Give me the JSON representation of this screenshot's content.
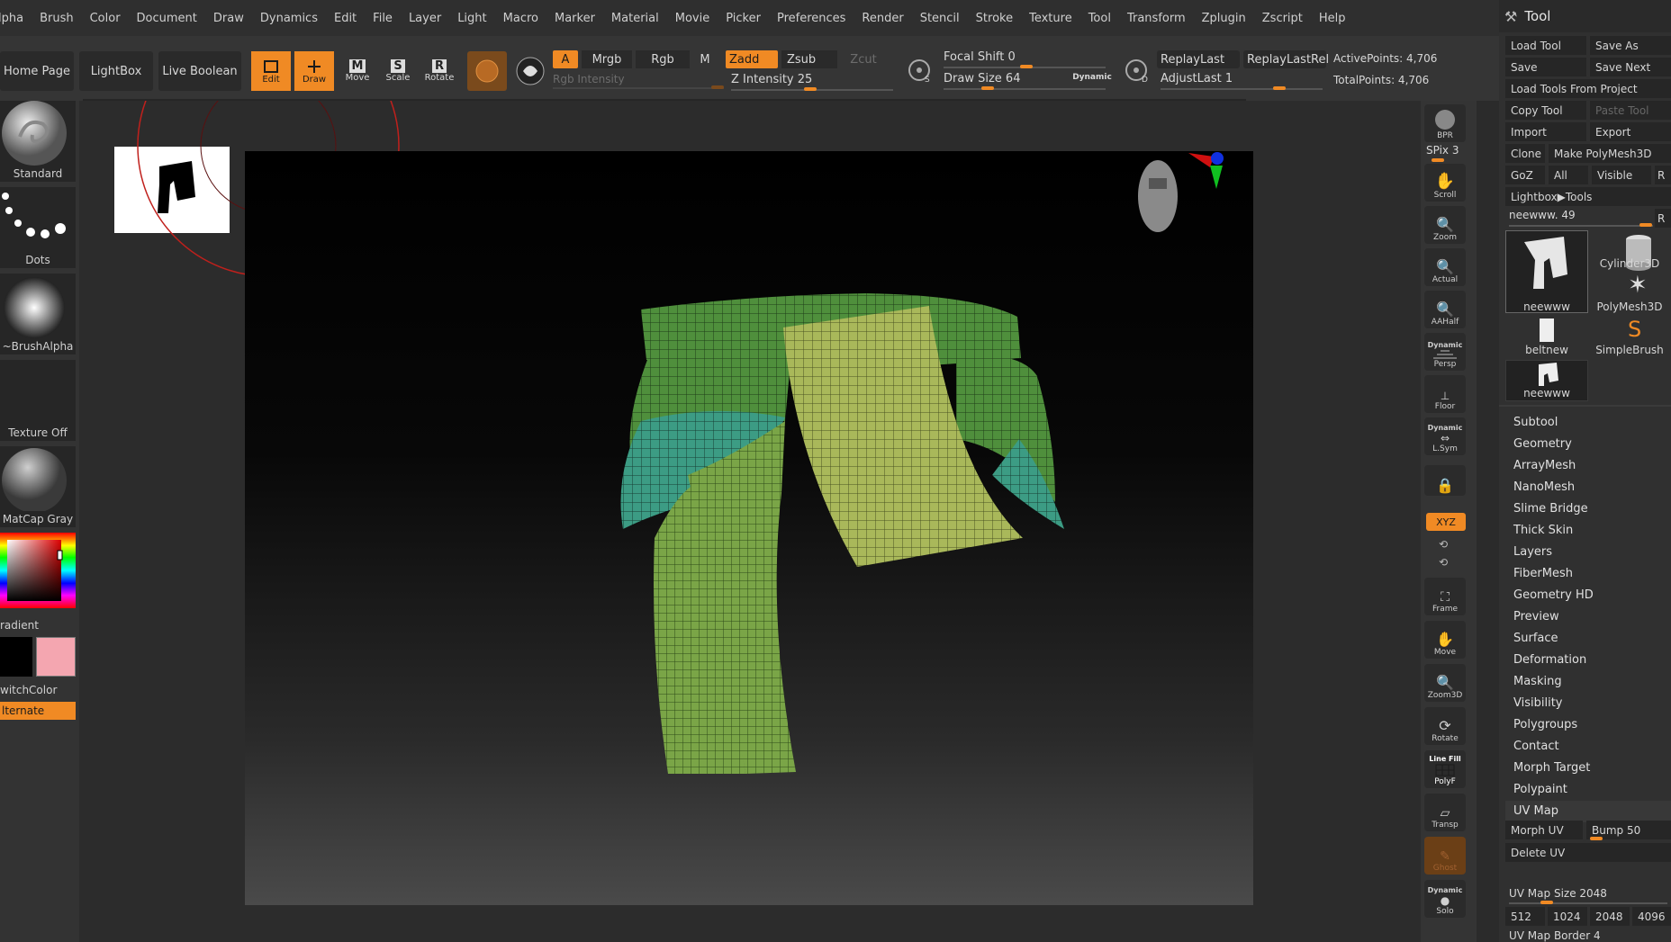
{
  "menubar": [
    "lpha",
    "Brush",
    "Color",
    "Document",
    "Draw",
    "Dynamics",
    "Edit",
    "File",
    "Layer",
    "Light",
    "Macro",
    "Marker",
    "Material",
    "Movie",
    "Picker",
    "Preferences",
    "Render",
    "Stencil",
    "Stroke",
    "Texture",
    "Tool",
    "Transform",
    "Zplugin",
    "Zscript",
    "Help"
  ],
  "toolbar": {
    "home_page": "Home Page",
    "lightbox": "LightBox",
    "live_boolean": "Live Boolean",
    "edit": "Edit",
    "draw": "Draw",
    "move": "Move",
    "scale": "Scale",
    "rotate": "Rotate",
    "a": "A",
    "mrgb": "Mrgb",
    "rgb": "Rgb",
    "m": "M",
    "rgb_intensity": "Rgb Intensity",
    "zadd": "Zadd",
    "zsub": "Zsub",
    "zcut": "Zcut",
    "z_intensity_label": "Z Intensity",
    "z_intensity_value": "25",
    "focal_shift_label": "Focal Shift",
    "focal_shift_value": "0",
    "draw_size_label": "Draw Size",
    "draw_size_value": "64",
    "dynamic": "Dynamic",
    "replay_last": "ReplayLast",
    "replay_last_rel": "ReplayLastRel",
    "adjust_last_label": "AdjustLast",
    "adjust_last_value": "1",
    "active_points": "ActivePoints: 4,706",
    "total_points": "TotalPoints: 4,706"
  },
  "leftshelf": {
    "standard": "Standard",
    "dots": "Dots",
    "brush_alpha": "~BrushAlpha",
    "texture_off": "Texture Off",
    "matcap": "MatCap Gray",
    "gradient": "radient",
    "switch_color": "witchColor",
    "alternate": "lternate",
    "secondary_color": "#f4a6b0"
  },
  "rightshelf": {
    "bpr": "BPR",
    "spix_label": "SPix",
    "spix_value": "3",
    "scroll": "Scroll",
    "zoom": "Zoom",
    "actual": "Actual",
    "aahalf": "AAHalf",
    "dynamic": "Dynamic",
    "persp": "Persp",
    "floor": "Floor",
    "dynamic2": "Dynamic",
    "lsym": "L.Sym",
    "xyz": "XYZ",
    "frame": "Frame",
    "move": "Move",
    "zoom3d": "Zoom3D",
    "rotate": "Rotate",
    "line_fill": "Line Fill",
    "polyf": "PolyF",
    "transp": "Transp",
    "ghost": "Ghost",
    "dynamic3": "Dynamic",
    "solo": "Solo"
  },
  "tool": {
    "title": "Tool",
    "load_tool": "Load Tool",
    "save_as": "Save As",
    "save": "Save",
    "save_next": "Save Next",
    "load_tools_from_project": "Load Tools From Project",
    "copy_tool": "Copy Tool",
    "paste_tool": "Paste Tool",
    "import": "Import",
    "export": "Export",
    "clone": "Clone",
    "make_polymesh": "Make PolyMesh3D",
    "goz": "GoZ",
    "all": "All",
    "visible": "Visible",
    "r": "R",
    "lightbox_tools": "Lightbox▶Tools",
    "current_tool_label": "neewww.",
    "current_tool_value": "49",
    "thumbs": [
      "neewww",
      "Cylinder3D",
      "PolyMesh3D",
      "beltnew",
      "SimpleBrush",
      "neewww"
    ],
    "sections": [
      "Subtool",
      "Geometry",
      "ArrayMesh",
      "NanoMesh",
      "Slime Bridge",
      "Thick Skin",
      "Layers",
      "FiberMesh",
      "Geometry HD",
      "Preview",
      "Surface",
      "Deformation",
      "Masking",
      "Visibility",
      "Polygroups",
      "Contact",
      "Morph Target",
      "Polypaint",
      "UV Map"
    ],
    "morph_uv": "Morph UV",
    "bump_label": "Bump",
    "bump_value": "50",
    "delete_uv": "Delete UV",
    "uv_map_size_label": "UV Map Size",
    "uv_map_size_value": "2048",
    "uv_sizes": [
      "512",
      "1024",
      "2048",
      "4096"
    ],
    "uv_map_border_label": "UV Map Border",
    "uv_map_border_value": "4"
  },
  "colors": {
    "accent": "#f08a24",
    "belt_green": "#4f8f3c",
    "belt_yellow": "#a9b85a",
    "belt_teal": "#3c9c84"
  }
}
